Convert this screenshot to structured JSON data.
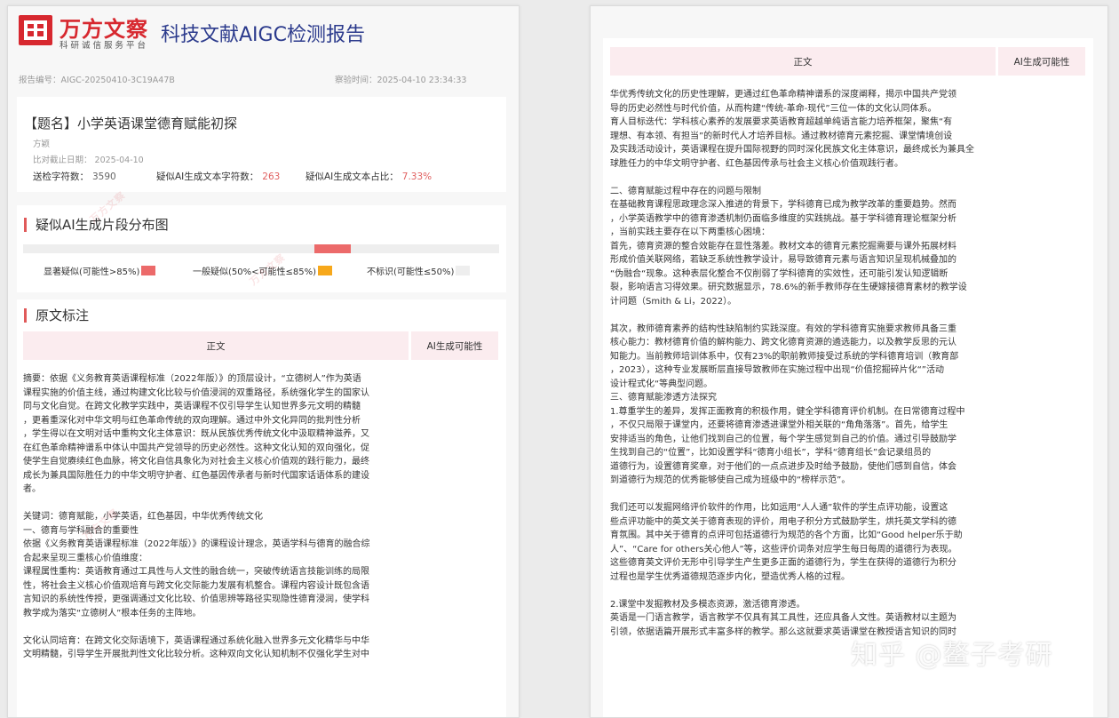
{
  "header": {
    "brand_name": "万方文察",
    "brand_sub": "科研诚信服务平台",
    "report_title": "科技文献AIGC检测报告",
    "report_no_label": "报告编号：",
    "report_no": "AIGC-20250410-3C19A47B",
    "check_time_label": "察验时间：",
    "check_time": "2025-04-10 23:34:33"
  },
  "doc": {
    "title": "【题名】小学英语课堂德育赋能初探",
    "author": "方颖",
    "cutoff": "比对截止日期：  2025-04-10",
    "stats": [
      {
        "label": "送检字符数：",
        "value": "3590",
        "tone": "normal"
      },
      {
        "label": "疑似AI生成文本字符数：",
        "value": "263",
        "tone": "red"
      },
      {
        "label": "疑似AI生成文本占比：",
        "value": "7.33%",
        "tone": "red"
      }
    ]
  },
  "distribution": {
    "title": "疑似AI生成片段分布图",
    "segments": [
      {
        "start": 0.612,
        "end": 0.688,
        "level": "high"
      }
    ],
    "legend": [
      {
        "label": "显著疑似(可能性>85%)",
        "color": "#ec6a6a"
      },
      {
        "label": "一般疑似(50%<可能性≤85%)",
        "color": "#f7a81b"
      },
      {
        "label": "不标识(可能性≤50%)",
        "color": "#eeeeee"
      }
    ]
  },
  "annotation": {
    "title": "原文标注",
    "col_text": "正文",
    "col_ai": "AI生成可能性"
  },
  "page1_text": "摘要：依据《义务教育英语课程标准（2022年版）》的顶层设计，“立德树人”作为英语\n课程实施的价值主线，通过构建文化比较与价值浸润的双重路径，系统强化学生的国家认\n同与文化自觉。在跨文化教学实践中，英语课程不仅引导学生认知世界多元文明的精髓\n，更着重深化对中华文明与红色革命传统的双向理解。通过中外文化异同的批判性分析\n，学生得以在文明对话中重构文化主体意识：既从民族优秀传统文化中汲取精神滋养，又\n在红色革命精神谱系中体认中国共产党领导的历史必然性。这种文化认知的双向强化，促\n使学生自觉赓续红色血脉，将文化自信具象化为对社会主义核心价值观的践行能力，最终\n成长为兼具国际胜任力的中华文明守护者、红色基因传承者与新时代国家话语体系的建设\n者。\n\n关键词：德育赋能，小学英语，红色基因，中华优秀传统文化\n一、德育与学科融合的重要性\n依据《义务教育英语课程标准（2022年版）》的课程设计理念，英语学科与德育的融合综\n合起来呈现三重核心价值维度：\n 课程属性重构：英语教育通过工具性与人文性的融合统一，突破传统语言技能训练的局限\n性，将社会主义核心价值观培育与跨文化交际能力发展有机整合。课程内容设计既包含语\n言知识的系统性传授，更强调通过文化比较、价值思辨等路径实现隐性德育浸润，使学科\n教学成为落实“立德树人”根本任务的主阵地。\n\n 文化认同培育：在跨文化交际语境下，英语课程通过系统化融入世界多元文化精华与中华\n文明精髓，引导学生开展批判性文化比较分析。这种双向文化认知机制不仅强化学生对中",
  "page2_text": "华优秀传统文化的历史性理解，更通过红色革命精神谱系的深度阐释，揭示中国共产党领\n导的历史必然性与时代价值，从而构建“传统-革命-现代”三位一体的文化认同体系。\n 育人目标迭代：学科核心素养的发展要求英语教育超越单纯语言能力培养框架，聚焦“有\n理想、有本领、有担当”的新时代人才培养目标。通过教材德育元素挖掘、课堂情境创设\n及实践活动设计，英语课程在提升国际视野的同时深化民族文化主体意识，最终成长为兼具全\n球胜任力的中华文明守护者、红色基因传承与社会主义核心价值观践行者。\n\n二、德育赋能过程中存在的问题与限制\n在基础教育课程思政理念深入推进的背景下，学科德育已成为教学改革的重要趋势。然而\n，小学英语教学中的德育渗透机制仍面临多维度的实践挑战。基于学科德育理论框架分析\n，当前实践主要存在以下两重核心困境：\n首先，德育资源的整合效能存在显性落差。教材文本的德育元素挖掘需要与课外拓展材料\n形成价值关联网络，若缺乏系统性教学设计，易导致德育元素与语言知识呈现机械叠加的\n“伪融合“现象。这种表层化整合不仅削弱了学科德育的实效性，还可能引发认知逻辑断\n裂，影响语言习得效果。研究数据显示，78.6%的新手教师存在生硬嫁接德育素材的教学设\n计问题（Smith & Li，2022）。\n\n其次，教师德育素养的结构性缺陷制约实践深度。有效的学科德育实施要求教师具备三重\n核心能力：教材德育价值的解构能力、跨文化德育资源的遴选能力，以及教学反思的元认\n知能力。当前教师培训体系中，仅有23%的职前教师接受过系统的学科德育培训（教育部\n，2023），这种专业发展断层直接导致教师在实施过程中出现“价值挖掘碎片化“”活动\n设计程式化“等典型问题。\n三、德育赋能渗透方法探究\n1.尊重学生的差异，发挥正面教育的积极作用，健全学科德育评价机制。在日常德育过程中\n，不仅只局限于课堂内，还要将德育渗透进课堂外相关联的“角角落落”。首先，给学生\n安排适当的角色，让他们找到自己的位置，每个学生感觉到自己的价值。通过引导鼓励学\n生找到自己的“位置”，比如设置学科“德育小组长”，学科“德育组长”会记录组员的\n道德行为，设置德育奖章，对于他们的一点点进步及时给予鼓励，使他们感到自信，体会\n到道德行为规范的优秀能够使自己成为班级中的“榜样示范”。\n\n我们还可以发掘网络评价软件的作用，比如运用“人人通”软件的学生点评功能，设置这\n些点评功能中的英文关于德育表现的评价，用电子积分方式鼓励学生，烘托英文学科的德\n育氛围。其中关于德育的点评可包括道德行为规范的各个方面，比如“Good helper乐于助\n人”、“Care for others关心他人”等，这些评价词条对应学生每日每周的道德行为表现。\n这些德育英文评价无形中引导学生产生更多正面的道德行为，学生在获得的道德行为积分\n过程也是学生优秀道德规范逐步内化，塑造优秀人格的过程。\n\n2.课堂中发掘教材及多模态资源，激活德育渗透。\n英语是一门语言教学，语言教学不仅具有其工具性，还应具备人文性。英语教材以主题为\n引领，依据语篇开展形式丰富多样的教学。那么这就要求英语课堂在教授语言知识的同时",
  "watermark": "万方文察",
  "credit": "知乎 @鳌子考研"
}
